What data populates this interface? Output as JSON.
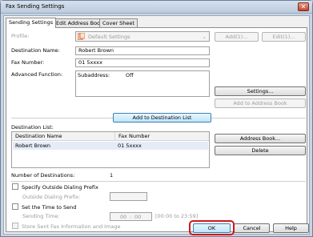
{
  "window": {
    "title": "Fax Sending Settings",
    "close_glyph": "✕"
  },
  "tabs": [
    "Sending Settings",
    "Edit Address Book",
    "Cover Sheet"
  ],
  "profile": {
    "label": "Profile:",
    "value": "Default Settings",
    "add_label": "Add(1)...",
    "edit_label": "Edit(1)..."
  },
  "destination_name": {
    "label": "Destination Name:",
    "value": "Robert Brown"
  },
  "fax_number": {
    "label": "Fax Number:",
    "value": "01 5xxxx"
  },
  "advanced": {
    "label": "Advanced Function:",
    "subaddress_label": "Subaddress:",
    "subaddress_value": "Off",
    "settings_label": "Settings...",
    "add_to_book_label": "Add to Address Book"
  },
  "add_to_list_label": "Add to Destination List",
  "destination_list": {
    "label": "Destination List:",
    "columns": [
      "Destination Name",
      "Fax Number"
    ],
    "rows": [
      {
        "name": "Robert Brown",
        "fax": "01 5xxxx"
      }
    ],
    "address_book_label": "Address Book...",
    "delete_label": "Delete"
  },
  "num_destinations": {
    "label": "Number of Destinations:",
    "value": "1"
  },
  "outside_prefix": {
    "checkbox_label": "Specify Outside Dialing Prefix",
    "field_label": "Outside Dialing Prefix:",
    "value": ""
  },
  "send_time": {
    "checkbox_label": "Set the Time to Send",
    "field_label": "Sending Time:",
    "hour": "00",
    "sep": ":",
    "minute": "00",
    "range": "[00:00 to 23:59]"
  },
  "store_fax_label": "Store Sent Fax Information and Image",
  "buttons": {
    "ok": "OK",
    "cancel": "Cancel",
    "help": "Help"
  },
  "colors": {
    "highlight": "#d01818",
    "selected_row": "#e4ecf7"
  }
}
